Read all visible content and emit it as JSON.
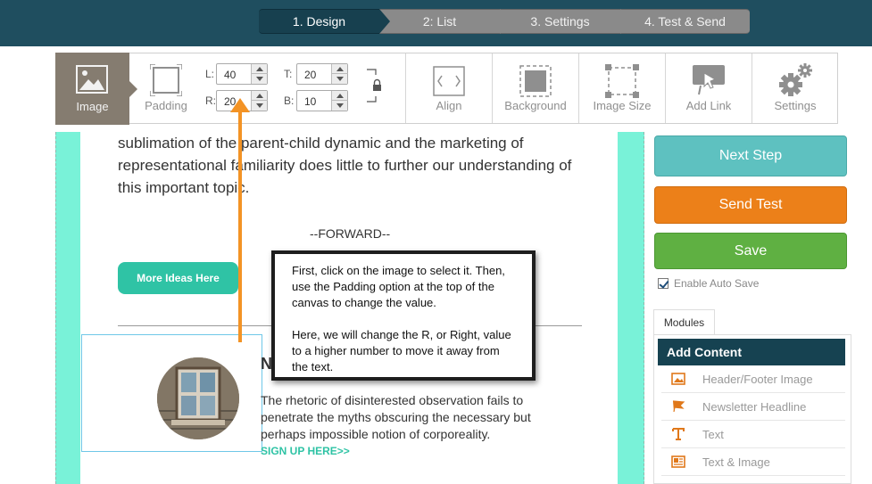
{
  "wizard": {
    "steps": [
      {
        "label": "1. Design",
        "active": true
      },
      {
        "label": "2: List",
        "active": false
      },
      {
        "label": "3. Settings",
        "active": false
      },
      {
        "label": "4. Test & Send",
        "active": false
      }
    ]
  },
  "toolbar": {
    "image_label": "Image",
    "padding_label": "Padding",
    "padding": {
      "left_key": "L:",
      "left_value": "40",
      "top_key": "T:",
      "top_value": "20",
      "right_key": "R:",
      "right_value": "20",
      "bottom_key": "B:",
      "bottom_value": "10"
    },
    "align_label": "Align",
    "background_label": "Background",
    "image_size_label": "Image Size",
    "add_link_label": "Add Link",
    "settings_label": "Settings"
  },
  "canvas": {
    "body_text": "sublimation of the parent-child dynamic and the marketing of representational familiarity does little to further our understanding of this important topic.",
    "forward": "--FORWARD--",
    "more_button": "More Ideas Here",
    "article_heading": "N",
    "article_text": "The rhetoric of disinterested observation fails to penetrate the myths obscuring the necessary but perhaps impossible notion of corporeality.",
    "signup_link": "SIGN UP HERE>>"
  },
  "callout": {
    "para1": "First, click on the image to select it. Then, use the Padding option at the top of the canvas to change the value.",
    "para2": "Here, we will change the R, or Right, value to a higher number to move it away from the text."
  },
  "sidebar": {
    "next_step": "Next Step",
    "send_test": "Send Test",
    "save": "Save",
    "auto_save": "Enable Auto Save",
    "auto_save_checked": true,
    "modules_tab": "Modules",
    "add_content": "Add Content",
    "items": [
      {
        "label": "Header/Footer Image",
        "icon": "image-icon"
      },
      {
        "label": "Newsletter Headline",
        "icon": "flag-icon"
      },
      {
        "label": "Text",
        "icon": "text-icon"
      },
      {
        "label": "Text & Image",
        "icon": "text-image-icon"
      }
    ]
  },
  "colors": {
    "header_bg": "#1f4e5f",
    "teal_accent": "#79f2d8",
    "button_teal": "#2fc3a5",
    "next_step": "#5ec1c0",
    "send_test": "#ec8019",
    "save": "#5fb042",
    "annotation_orange": "#f39325"
  }
}
